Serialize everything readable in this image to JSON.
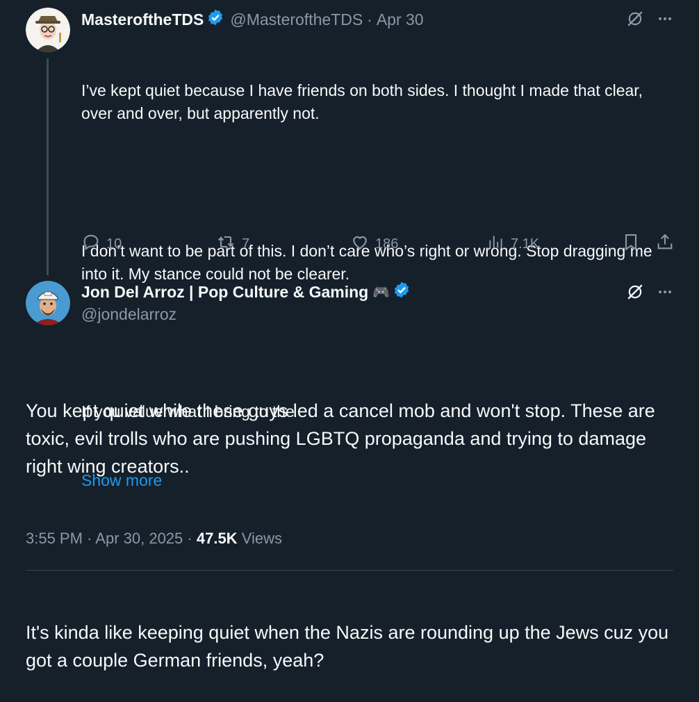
{
  "tweet1": {
    "display_name": "MasteroftheTDS",
    "handle": "@MasteroftheTDS",
    "separator": "·",
    "date": "Apr 30",
    "paragraphs": [
      "I’ve kept quiet because I have friends on both sides. I thought I made that clear, over and over, but apparently not.",
      "I don’t want to be part of this. I don’t care who’s right or wrong. Stop dragging me into it. My stance could not be clearer.",
      "If you value what I bring to the"
    ],
    "show_more": "Show more",
    "stats": {
      "replies": "10",
      "retweets": "7",
      "likes": "186",
      "views": "7.1K"
    }
  },
  "tweet2": {
    "display_name": "Jon Del Arroz | Pop Culture & Gaming",
    "emoji": "🎮",
    "handle": "@jondelarroz",
    "paragraphs": [
      "You kept quiet while these guys led a cancel mob and won't stop. These are toxic, evil trolls who are pushing LGBTQ propaganda and trying to damage right wing creators..",
      "It's kinda like keeping quiet when the Nazis are rounding up the Jews cuz you got a couple German friends, yeah?"
    ],
    "time": "3:55 PM",
    "separator": "·",
    "date": "Apr 30, 2025",
    "views_count": "47.5K",
    "views_label": "Views"
  },
  "colors": {
    "background": "#15202b",
    "text": "#f7f9f9",
    "muted": "#8b98a5",
    "link": "#1d9bf0",
    "verified": "#1d9bf0"
  },
  "icons": [
    "verified-badge-icon",
    "grok-icon",
    "more-icon",
    "reply-icon",
    "retweet-icon",
    "like-icon",
    "views-icon",
    "bookmark-icon",
    "share-icon"
  ]
}
